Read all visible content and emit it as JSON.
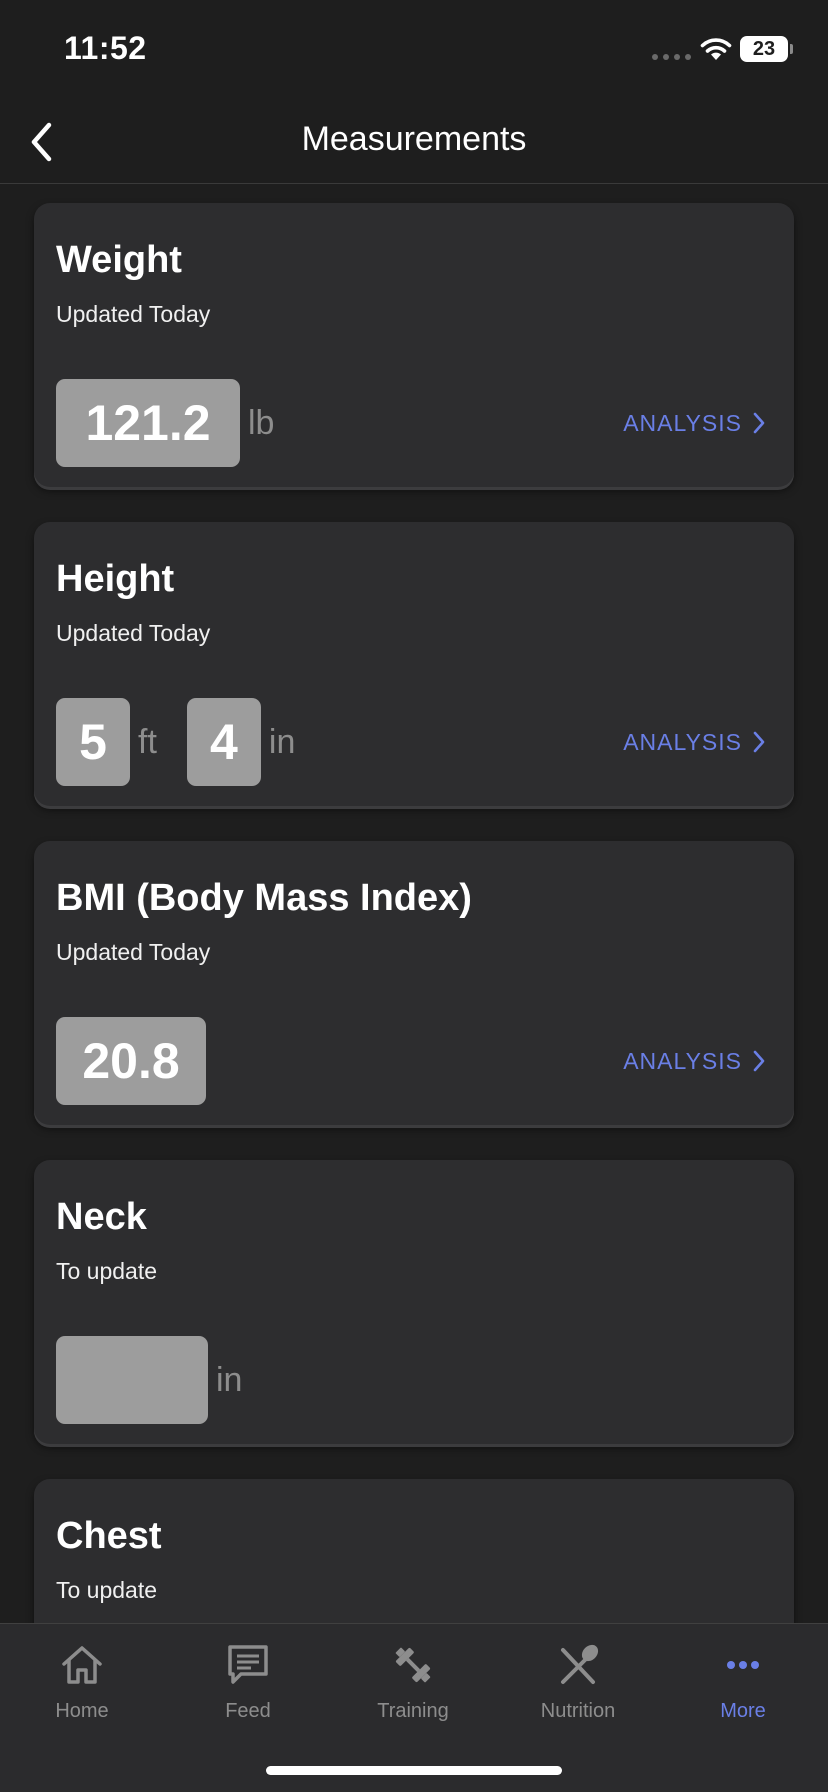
{
  "status": {
    "time": "11:52",
    "battery": "23"
  },
  "nav": {
    "title": "Measurements"
  },
  "cards": [
    {
      "title": "Weight",
      "subtitle": "Updated Today",
      "values": [
        {
          "value": "121.2",
          "unit": "lb"
        }
      ],
      "analysis": "ANALYSIS"
    },
    {
      "title": "Height",
      "subtitle": "Updated Today",
      "values": [
        {
          "value": "5",
          "unit": "ft"
        },
        {
          "value": "4",
          "unit": "in"
        }
      ],
      "analysis": "ANALYSIS"
    },
    {
      "title": "BMI (Body Mass Index)",
      "subtitle": "Updated Today",
      "values": [
        {
          "value": "20.8",
          "unit": ""
        }
      ],
      "analysis": "ANALYSIS"
    },
    {
      "title": "Neck",
      "subtitle": "To update",
      "values": [
        {
          "value": "",
          "unit": "in"
        }
      ]
    },
    {
      "title": "Chest",
      "subtitle": "To update"
    }
  ],
  "tabs": [
    {
      "label": "Home",
      "icon": "home-icon"
    },
    {
      "label": "Feed",
      "icon": "feed-icon"
    },
    {
      "label": "Training",
      "icon": "dumbbell-icon"
    },
    {
      "label": "Nutrition",
      "icon": "fork-spoon-icon"
    },
    {
      "label": "More",
      "icon": "more-icon",
      "active": true
    }
  ],
  "colors": {
    "accent": "#6a7fe6",
    "card": "#2d2d2f",
    "background": "#1e1e1e",
    "value_box": "#9d9d9d"
  }
}
